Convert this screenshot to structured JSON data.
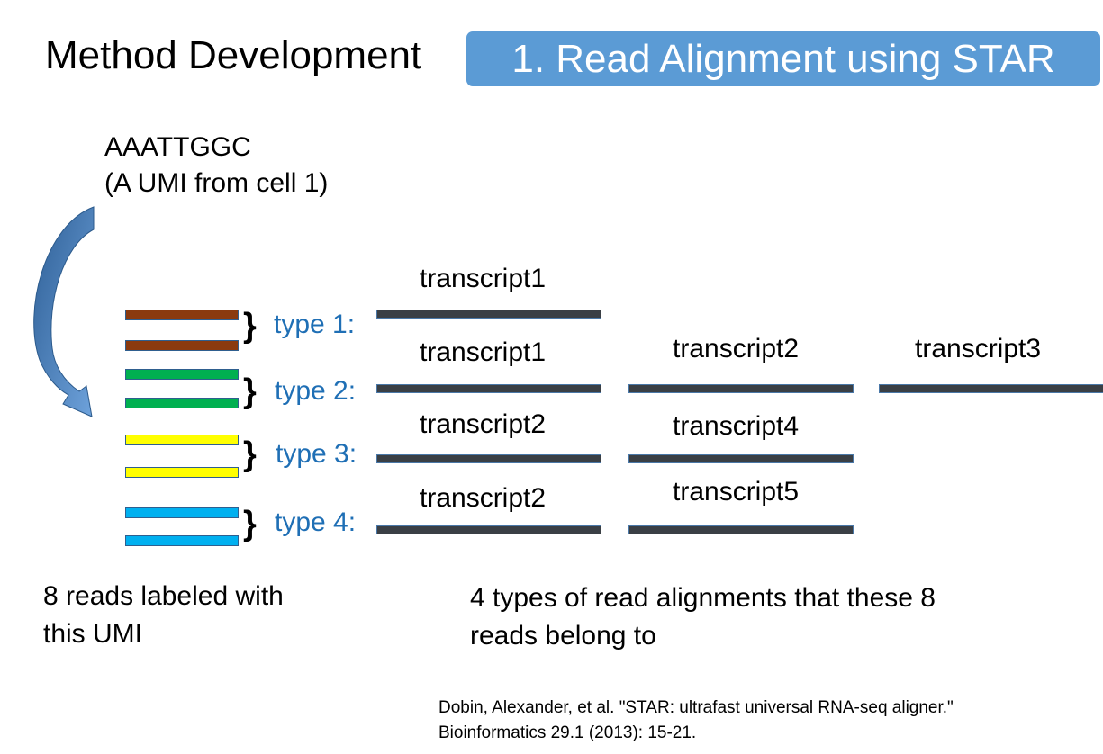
{
  "header": {
    "title": "Method Development",
    "badge": "1. Read Alignment using STAR"
  },
  "umi": {
    "sequence": "AAATTGGC",
    "note": "(A UMI from cell 1)"
  },
  "reads": {
    "colors": [
      "#8b3a0e",
      "#8b3a0e",
      "#00b050",
      "#00b050",
      "#ffff00",
      "#ffff00",
      "#00b0f0",
      "#00b0f0"
    ]
  },
  "types": [
    {
      "label": "type 1:",
      "transcripts": [
        "transcript1"
      ]
    },
    {
      "label": "type 2:",
      "transcripts": [
        "transcript1",
        "transcript2",
        "transcript3"
      ]
    },
    {
      "label": "type 3:",
      "transcripts": [
        "transcript2",
        "transcript4"
      ]
    },
    {
      "label": "type 4:",
      "transcripts": [
        "transcript2",
        "transcript5"
      ]
    }
  ],
  "summary": {
    "reads_line1": "8  reads labeled with",
    "reads_line2": "this UMI",
    "alignments_line1": "4 types of read alignments that these 8",
    "alignments_line2": "reads belong to"
  },
  "citation": {
    "line1": "Dobin, Alexander, et al. \"STAR: ultrafast universal RNA-seq aligner.\"",
    "line2": "Bioinformatics 29.1 (2013): 15-21."
  },
  "colors": {
    "badge_bg": "#5b9bd5",
    "type_label": "#1f6fb5",
    "arrow": "#3d78b8",
    "alignment_bar": "#3a3f45"
  }
}
